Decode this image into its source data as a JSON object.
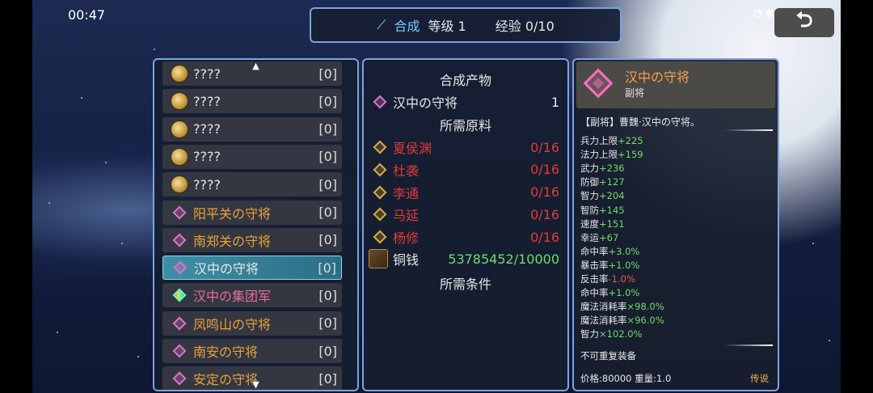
{
  "status_bar": {
    "time": "00:47"
  },
  "top_bar": {
    "mode": "合成",
    "level_label": "等级 1",
    "exp_label": "经验 0/10"
  },
  "back_button": {
    "symbol": "⮌"
  },
  "recipe_list": [
    {
      "name": "????",
      "count": "[0]",
      "icon": "coin-icon",
      "style": "unknown"
    },
    {
      "name": "????",
      "count": "[0]",
      "icon": "coin-icon",
      "style": "unknown"
    },
    {
      "name": "????",
      "count": "[0]",
      "icon": "coin-icon",
      "style": "unknown"
    },
    {
      "name": "????",
      "count": "[0]",
      "icon": "coin-icon",
      "style": "unknown"
    },
    {
      "name": "????",
      "count": "[0]",
      "icon": "coin-icon",
      "style": "unknown"
    },
    {
      "name": "阳平关の守将",
      "count": "[0]",
      "icon": "pink-gem-icon",
      "style": "gold"
    },
    {
      "name": "南郑关の守将",
      "count": "[0]",
      "icon": "pink-gem-icon",
      "style": "gold"
    },
    {
      "name": "汉中の守将",
      "count": "[0]",
      "icon": "pink-gem-icon",
      "style": "selected"
    },
    {
      "name": "汉中の集团军",
      "count": "[0]",
      "icon": "rainbow-gem-icon",
      "style": "pink"
    },
    {
      "name": "凤鸣山の守将",
      "count": "[0]",
      "icon": "pink-gem-icon",
      "style": "gold"
    },
    {
      "name": "南安の守将",
      "count": "[0]",
      "icon": "pink-gem-icon",
      "style": "gold"
    },
    {
      "name": "安定の守将",
      "count": "[0]",
      "icon": "pink-gem-icon",
      "style": "gold"
    }
  ],
  "synthesis": {
    "product_header": "合成产物",
    "product": {
      "name": "汉中の守将",
      "qty": "1"
    },
    "materials_header": "所需原料",
    "materials": [
      {
        "name": "夏侯渊",
        "progress": "0/16"
      },
      {
        "name": "杜袭",
        "progress": "0/16"
      },
      {
        "name": "李通",
        "progress": "0/16"
      },
      {
        "name": "马延",
        "progress": "0/16"
      },
      {
        "name": "杨修",
        "progress": "0/16"
      }
    ],
    "currency": {
      "name": "铜钱",
      "progress": "53785452/10000"
    },
    "conditions_header": "所需条件"
  },
  "detail": {
    "title": "汉中の守将",
    "subtitle": "副将",
    "description": "【副将】曹魏·汉中の守将。",
    "stats": [
      {
        "label": "兵力上限",
        "value": "+225",
        "tone": "g"
      },
      {
        "label": "法力上限",
        "value": "+159",
        "tone": "g"
      },
      {
        "label": "武力",
        "value": "+236",
        "tone": "g"
      },
      {
        "label": "防御",
        "value": "+127",
        "tone": "g"
      },
      {
        "label": "智力",
        "value": "+204",
        "tone": "g"
      },
      {
        "label": "智防",
        "value": "+145",
        "tone": "g"
      },
      {
        "label": "速度",
        "value": "+151",
        "tone": "g"
      },
      {
        "label": "幸运",
        "value": "+67",
        "tone": "g"
      },
      {
        "label": "命中率",
        "value": "+3.0%",
        "tone": "g"
      },
      {
        "label": "暴击率",
        "value": "+1.0%",
        "tone": "g"
      },
      {
        "label": "反击率",
        "value": "-1.0%",
        "tone": "r"
      },
      {
        "label": "命中率",
        "value": "+1.0%",
        "tone": "g"
      },
      {
        "label": "魔法消耗率",
        "value": "×98.0%",
        "tone": "g"
      },
      {
        "label": "魔法消耗率",
        "value": "×96.0%",
        "tone": "g"
      },
      {
        "label": "智力",
        "value": "×102.0%",
        "tone": "g"
      }
    ],
    "note": "不可重复装备",
    "price_weight": "价格:80000 重量:1.0",
    "rarity": "传说"
  }
}
